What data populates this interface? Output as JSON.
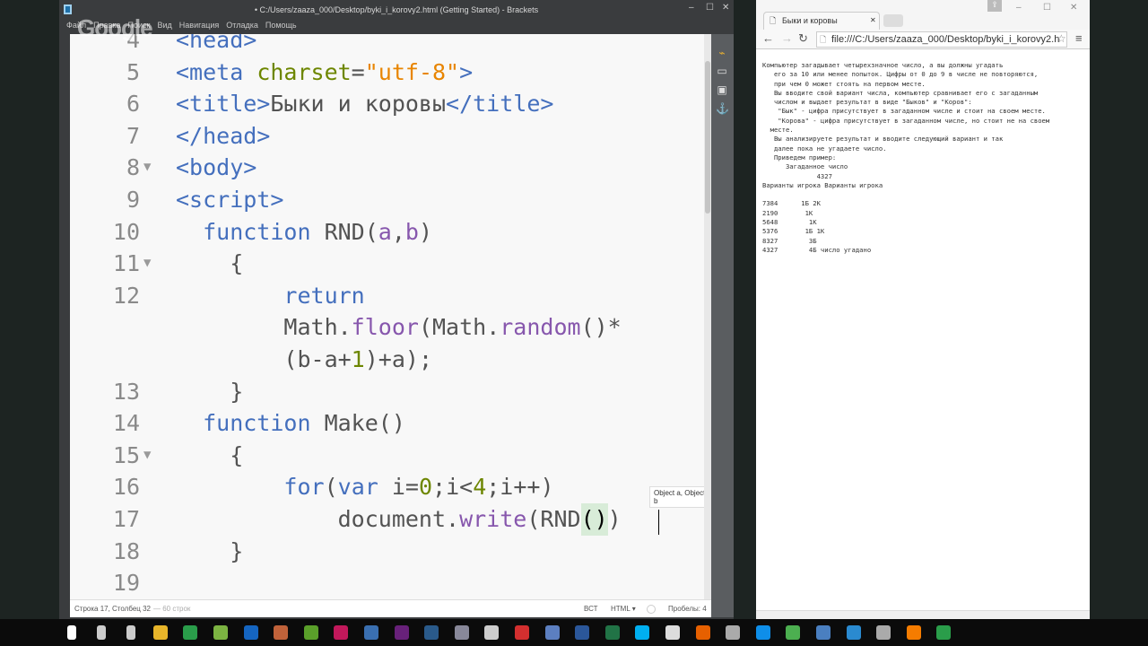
{
  "brackets": {
    "title": "• C:/Users/zaaza_000/Desktop/byki_i_korovy2.html (Getting Started) - Brackets",
    "menu": [
      "Файл",
      "Правка",
      "Поиск",
      "Вид",
      "Навигация",
      "Отладка",
      "Помощь"
    ],
    "watermark": "Google",
    "tooltip": "Object a, Object b",
    "status": {
      "position": "Строка 17, Столбец 32",
      "lines": " — 60 строк",
      "mode": "ВСТ",
      "language": "HTML ▾",
      "spaces": "Пробелы: 4"
    },
    "lines": [
      {
        "n": "4",
        "f": "",
        "t": [
          [
            "<head>",
            "tag"
          ]
        ]
      },
      {
        "n": "5",
        "f": "",
        "t": [
          [
            "<meta ",
            "tag"
          ],
          [
            "charset",
            "attr"
          ],
          [
            "=",
            "txt"
          ],
          [
            "\"utf-8\"",
            "str"
          ],
          [
            ">",
            "tag"
          ]
        ]
      },
      {
        "n": "6",
        "f": "",
        "t": [
          [
            "<title>",
            "tag"
          ],
          [
            "Быки и коровы",
            "txt"
          ],
          [
            "</title>",
            "tag"
          ]
        ]
      },
      {
        "n": "7",
        "f": "",
        "t": [
          [
            "</head>",
            "tag"
          ]
        ]
      },
      {
        "n": "8",
        "f": "▼",
        "t": [
          [
            "<body>",
            "tag"
          ]
        ]
      },
      {
        "n": "9",
        "f": "",
        "t": [
          [
            "<script>",
            "tag"
          ]
        ]
      },
      {
        "n": "10",
        "f": "",
        "t": [
          [
            "  function ",
            "kw"
          ],
          [
            "RND(",
            "txt"
          ],
          [
            "a",
            "prop"
          ],
          [
            ",",
            "txt"
          ],
          [
            "b",
            "prop"
          ],
          [
            ")",
            "txt"
          ]
        ]
      },
      {
        "n": "11",
        "f": "▼",
        "t": [
          [
            "    {",
            "txt"
          ]
        ]
      },
      {
        "n": "12",
        "f": "",
        "t": [
          [
            "        return",
            "kw"
          ]
        ]
      },
      {
        "n": "",
        "f": "",
        "t": [
          [
            "        Math.",
            "txt"
          ],
          [
            "floor",
            "prop"
          ],
          [
            "(Math.",
            "txt"
          ],
          [
            "random",
            "prop"
          ],
          [
            "()*",
            "txt"
          ]
        ]
      },
      {
        "n": "",
        "f": "",
        "t": [
          [
            "        (b-a+",
            "txt"
          ],
          [
            "1",
            "numv"
          ],
          [
            ")+a);",
            "txt"
          ]
        ]
      },
      {
        "n": "13",
        "f": "",
        "t": [
          [
            "    }",
            "txt"
          ]
        ]
      },
      {
        "n": "14",
        "f": "",
        "t": [
          [
            "  function ",
            "kw"
          ],
          [
            "Make()",
            "txt"
          ]
        ]
      },
      {
        "n": "15",
        "f": "▼",
        "t": [
          [
            "    {",
            "txt"
          ]
        ]
      },
      {
        "n": "16",
        "f": "",
        "t": [
          [
            "        for",
            "kw"
          ],
          [
            "(",
            "txt"
          ],
          [
            "var ",
            "kw"
          ],
          [
            "i=",
            "txt"
          ],
          [
            "0",
            "numv"
          ],
          [
            ";i<",
            "txt"
          ],
          [
            "4",
            "numv"
          ],
          [
            ";i++)",
            "txt"
          ]
        ]
      },
      {
        "n": "17",
        "f": "",
        "t": [
          [
            "            document.",
            "txt"
          ],
          [
            "write",
            "prop"
          ],
          [
            "(RND",
            "txt"
          ],
          [
            "()",
            "br"
          ],
          [
            ")",
            "txt"
          ]
        ]
      },
      {
        "n": "18",
        "f": "",
        "t": [
          [
            "    }",
            "txt"
          ]
        ]
      },
      {
        "n": "19",
        "f": "",
        "t": [
          [
            "",
            "txt"
          ]
        ]
      }
    ]
  },
  "browser": {
    "tab_title": "Быки и коровы",
    "url": "file:///C:/Users/zaaza_000/Desktop/byki_i_korovy2.h",
    "content": "Компьютер загадывает четырехзначное число, а вы должны угадать\n   его за 10 или менее попыток. Цифры от 0 до 9 в числе не повторяются,\n   при чем 0 может стоять на первом месте.\n   Вы вводите свой вариант числа, компьютер сравнивает его с загаданным\n   числом и выдает результат в виде \"Быков\" и \"Коров\":\n    \"Бык\" - цифра присутствует в загаданном числе и стоит на своем месте.\n    \"Корова\" - цифра присутствует в загаданном числе, но стоит не на своем\n  месте.\n   Вы анализируете результат и вводите следующий вариант и так\n   далее пока не угадаете число.\n   Приведем пример:\n      Загаданное число\n              4327\nВарианты игрока Варианты игрока\n\n7384      1Б 2К\n2190       1К\n5648        1К\n5376       1Б 1К\n8327        3Б\n4327        4Б число угадано"
  },
  "taskbar": {
    "icons": [
      "windows-start",
      "search",
      "task-view",
      "file-explorer",
      "chrome",
      "notepad-plus",
      "app-blue",
      "app-brown",
      "app-green",
      "app-pink",
      "abbyy",
      "visual-studio",
      "app-net",
      "app-person",
      "app-unity",
      "app-red",
      "app-search",
      "word",
      "excel",
      "skype",
      "calculator",
      "firefox",
      "app-cat",
      "teamviewer",
      "app-q",
      "app-blue2",
      "brackets",
      "app-pen",
      "xampp",
      "chrome2"
    ]
  }
}
